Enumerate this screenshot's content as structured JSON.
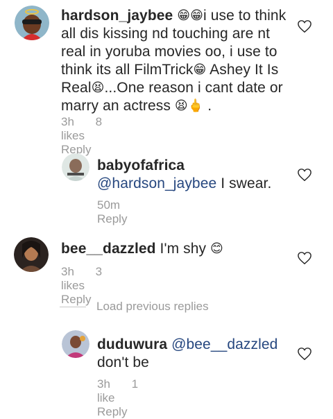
{
  "comments": [
    {
      "username": "hardson_jaybee",
      "text_parts": [
        "i use to think all dis kissing nd touching are nt real in yoruba movies oo, i use to think its all FilmTrick",
        " Ashey It Is Real",
        "...One reason i cant date or marry an actress ",
        " ."
      ],
      "emoji": [
        "grinning-face",
        "grinning-face",
        "grinning-face",
        "tired-face",
        "tired-face",
        "raised-finger"
      ],
      "time": "3h",
      "likes": "8 likes",
      "reply": "Reply"
    },
    {
      "username": "babyofafrica",
      "mention": "@hardson_jaybee",
      "text": " I swear.",
      "time": "50m",
      "reply": "Reply"
    },
    {
      "username": "bee__dazzled",
      "text": " I'm shy ",
      "emoji": [
        "blushing-face"
      ],
      "time": "3h",
      "likes": "3 likes",
      "reply": "Reply"
    },
    {
      "username": "duduwura",
      "mention": "@bee__dazzled",
      "text": "don't be",
      "time": "3h",
      "likes": "1 like",
      "reply": "Reply"
    }
  ],
  "load_previous": "Load previous replies",
  "colors": {
    "username": "#262626",
    "mention": "#26477f",
    "meta": "#9a9a9a",
    "emoji_yellow": "#f7c23a"
  }
}
